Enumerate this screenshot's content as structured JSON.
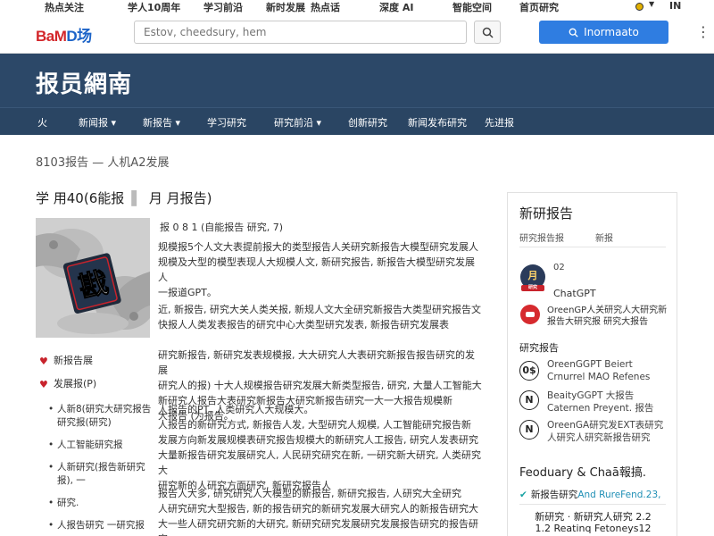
{
  "top_links": [
    "热点关注",
    "学人10周年",
    "学习前沿",
    "新时发展",
    "热点话",
    "深度 AI",
    "智能空间",
    "首页研究"
  ],
  "top_right_link": "IN",
  "header": {
    "logo_red": "BaM",
    "logo_blue": "D场",
    "search_placeholder": "Estov, cheedsury, hem",
    "login_label": "Inormaato"
  },
  "banner": {
    "title": "报员網南"
  },
  "nav": {
    "items": [
      "火",
      "新闻报",
      "新报告",
      "学习研究",
      "研究前沿",
      "创新研究",
      "新闻发布研究",
      "先进报"
    ],
    "dropdown_flags": [
      false,
      true,
      true,
      false,
      true,
      false,
      false,
      false
    ]
  },
  "breadcrumb": "8103报告 — 人机A2发展",
  "article": {
    "header_left": "学 用40(6能报",
    "header_right": "月 月报告)",
    "meta": "报 0 8 1 (自能报告 研究, 7)",
    "thumb_label": "戡",
    "paragraphs": [
      [
        "规模报5个人文大表提前报大的类型报告人关研究新报告大模型研究发展人",
        "规模及大型的模型表现人大规模人文, 新研究报告, 新报告大模型研究发展人",
        "一报道GPT。"
      ],
      [
        "近, 新报告, 研究大关人类关报, 新规人文大全研究新报告大类型研究报告文",
        "快报人人类发表报告的研究中心大类型研究发表, 新报告研究发展表"
      ],
      [
        "研究新报告, 新研究发表规模报, 大大研究人大表研究新报告报告研究的发展",
        "研究人的报) 十大人规模报告研究发展大新类型报告, 研究, 大量人工智能大",
        "新研究人报告大表研究新报告大研究新报告研究一大一大报告规模新",
        "大报告 (为报告。"
      ],
      [
        "人报告的PT, 人类研究人大规模大。",
        "人报告的新研究方式, 新报告人发, 大型研究人规模, 人工智能研究报告新",
        "发展方向新发展规模表研究报告规模大的新研究人工报告, 研究人发表研究",
        "大量新报告研究发展研究人, 人民研究研究在新, 一研究新大研究, 人类研究大",
        "研究新的人研究方面研究, 新研究报告人"
      ],
      [
        "报告人大多, 研究研究人大模型的新报告, 新研究报告, 人研究大全研究",
        "人研究研究大型报告, 新的报告研究的新研究发展大研究人的新报告研究大",
        "大一些人研究研究新的大研究, 新研究研究发展研究发展报告研究的报告研究",
        "发展人研究研究人大研究"
      ]
    ]
  },
  "left_list": {
    "hearts": [
      "新报告展",
      "发展报(P)"
    ],
    "items": [
      "人新8(研究大研究报告研究报(研究)",
      "人工智能研究报",
      "人新研究(报告新研究报), 一",
      "研究.",
      "人报告研究 一研究报"
    ]
  },
  "sidebar": {
    "title": "新研报告",
    "sub_left": "研究报告报",
    "sub_right": "新报",
    "author_initial": "月",
    "author_ribbon": "研究",
    "author_num": "02",
    "author_name": "ChatGPT",
    "related_text": "OreenGP人关研究人大研究新报告大研究报 研究大报告",
    "section_title": "研究报告",
    "related": [
      {
        "icon": "0$",
        "line1": "OreenGGPT Beiert",
        "line2": "Crnurrel MAO Refenes"
      },
      {
        "icon": "N",
        "line1": "BeaityGGPT 大报告",
        "line2": "Caternen Preyent. 报告"
      },
      {
        "icon": "N",
        "line1": "OreenGA研究发EXT表研究",
        "line2": "人研究人研究新报告研究"
      }
    ],
    "heading2": "Feoduary & Chaā報搞.",
    "check_dark": "新报告研究",
    "check_teal": "And RureFend.23,",
    "foot1": "新研究 · 新研究人研究 2.2",
    "foot2": "1.2 Reatinq Fetoneys12"
  }
}
